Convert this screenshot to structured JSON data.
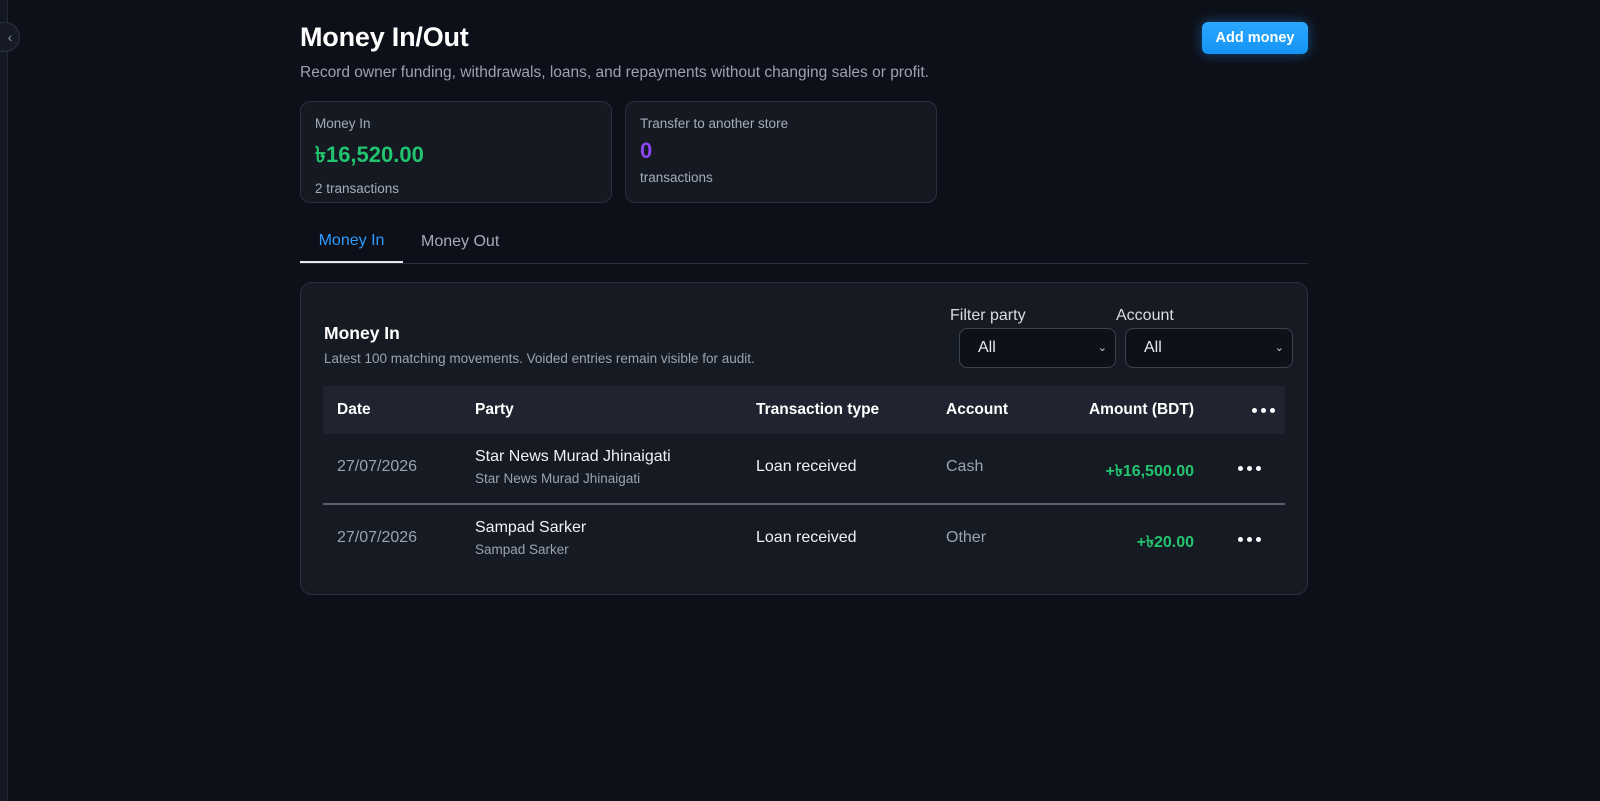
{
  "page": {
    "title": "Money In/Out",
    "subtitle": "Record owner funding, withdrawals, loans, and repayments without changing sales or profit.",
    "add_button": "Add money"
  },
  "stats": [
    {
      "label": "Money In",
      "value": "৳16,520.00",
      "sub": "2 transactions",
      "color": "#22c56f"
    },
    {
      "label": "Transfer to another store",
      "value": "0",
      "sub": "transactions",
      "color": "#8b46f0"
    }
  ],
  "tabs": [
    {
      "label": "Money In",
      "active": true
    },
    {
      "label": "Money Out",
      "active": false
    }
  ],
  "panel": {
    "title": "Money In",
    "subtitle": "Latest 100 matching movements. Voided entries remain visible for audit.",
    "filters": [
      {
        "label": "Filter party",
        "value": "All"
      },
      {
        "label": "Account",
        "value": "All"
      }
    ]
  },
  "table": {
    "columns": [
      "Date",
      "Party",
      "Transaction type",
      "Account",
      "Amount (BDT)"
    ],
    "rows": [
      {
        "date": "27/07/2026",
        "party": "Star News Murad Jhinaigati",
        "party_sub": "Star News Murad Jhinaigati",
        "type": "Loan received",
        "account": "Cash",
        "amount": "+৳16,500.00"
      },
      {
        "date": "27/07/2026",
        "party": "Sampad Sarker",
        "party_sub": "Sampad Sarker",
        "type": "Loan received",
        "account": "Other",
        "amount": "+৳20.00"
      }
    ]
  },
  "icons": {
    "collapse": "chevron-left-icon",
    "select": "chevron-down-icon",
    "menu": "more-horizontal-icon"
  },
  "colors": {
    "accent": "#2e9bff",
    "positive": "#22c56f",
    "transfer": "#8b46f0"
  }
}
